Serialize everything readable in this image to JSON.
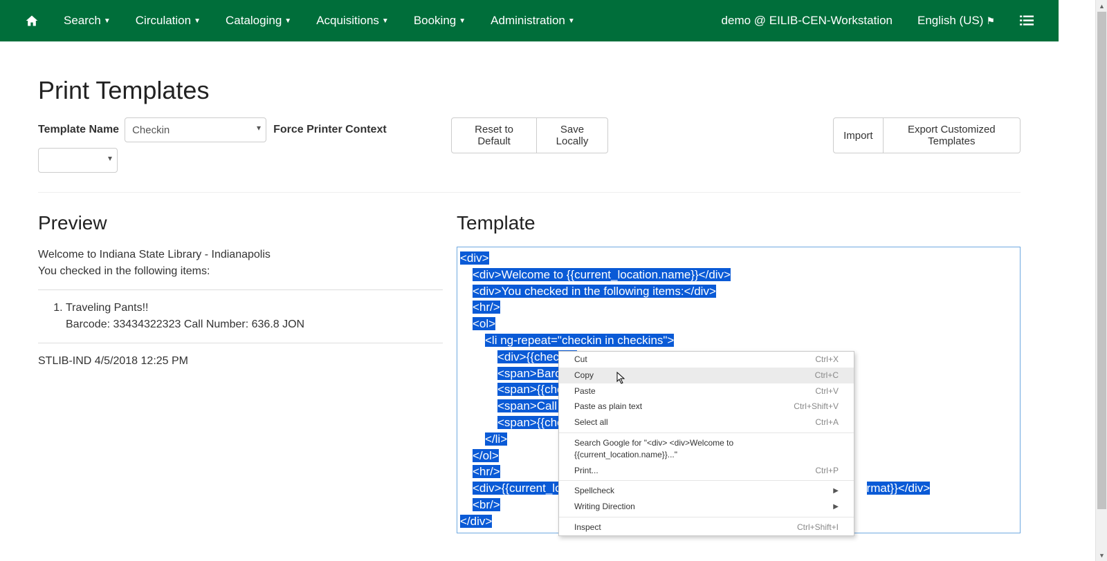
{
  "nav": {
    "items": [
      "Search",
      "Circulation",
      "Cataloging",
      "Acquisitions",
      "Booking",
      "Administration"
    ],
    "user": "demo @ EILIB-CEN-Workstation",
    "lang": "English (US)"
  },
  "page": {
    "title": "Print Templates",
    "template_label": "Template Name",
    "template_selected": "Checkin",
    "force_label": "Force Printer Context",
    "context_selected": "",
    "reset": "Reset to Default",
    "save": "Save Locally",
    "import": "Import",
    "export": "Export Customized Templates"
  },
  "preview": {
    "heading": "Preview",
    "welcome": "Welcome to Indiana State Library - Indianapolis",
    "intro": "You checked in the following items:",
    "item_title": "Traveling Pants!!",
    "item_detail": "Barcode: 33434322323 Call Number: 636.8 JON",
    "footer": "STLIB-IND 4/5/2018 12:25 PM"
  },
  "template": {
    "heading": "Template",
    "lines": [
      "<div>",
      "<div>Welcome to {{current_location.name}}</div>",
      "<div>You checked in the following items:</div>",
      "<hr/>",
      "<ol>",
      "<li ng-repeat=\"checkin in checkins\">",
      "<div>{{checkin.",
      "<span>Barcod",
      "<span>{{check",
      "<span>Call Nu",
      "<span>{{check",
      "</li>",
      "</ol>",
      "<hr/>",
      "<div>{{current_lo",
      "rmat}}</div>",
      "<br/>",
      "</div>"
    ],
    "indent": [
      0,
      1,
      1,
      1,
      1,
      2,
      3,
      3,
      3,
      3,
      3,
      2,
      1,
      1,
      1,
      0,
      1,
      0
    ],
    "cut_after_menu": [
      false,
      false,
      false,
      false,
      false,
      false,
      true,
      true,
      true,
      true,
      true,
      false,
      false,
      false,
      true,
      false,
      false,
      false
    ],
    "resume_col": 576
  },
  "context_menu": {
    "items": [
      {
        "label": "Cut",
        "shortcut": "Ctrl+X"
      },
      {
        "label": "Copy",
        "shortcut": "Ctrl+C",
        "hover": true
      },
      {
        "label": "Paste",
        "shortcut": "Ctrl+V"
      },
      {
        "label": "Paste as plain text",
        "shortcut": "Ctrl+Shift+V"
      },
      {
        "label": "Select all",
        "shortcut": "Ctrl+A"
      },
      {
        "sep": true
      },
      {
        "label": "Search Google for \"<div>    <div>Welcome to {{current_location.name}}...\""
      },
      {
        "label": "Print...",
        "shortcut": "Ctrl+P"
      },
      {
        "sep": true
      },
      {
        "label": "Spellcheck",
        "submenu": true
      },
      {
        "label": "Writing Direction",
        "submenu": true
      },
      {
        "sep": true
      },
      {
        "label": "Inspect",
        "shortcut": "Ctrl+Shift+I"
      }
    ]
  }
}
